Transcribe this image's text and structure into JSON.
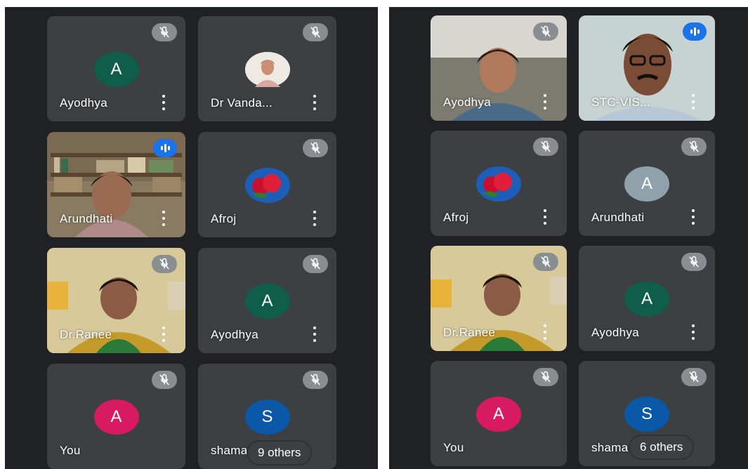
{
  "colors": {
    "background": "#202124",
    "tile": "#3c4043",
    "speaking": "#1a73e8",
    "muted_badge": "#8a8d91"
  },
  "icons": {
    "muted": "mic-off-icon",
    "speaking": "audio-level-icon",
    "menu": "more-vert-icon"
  },
  "left": {
    "tiles": [
      {
        "name": "Ayodhya",
        "avatar_letter": "A",
        "avatar_color": "#0f5e49"
      },
      {
        "name": "Dr Vanda..."
      },
      {
        "name": "Arundhati"
      },
      {
        "name": "Afroj"
      },
      {
        "name": "Dr.Ranee"
      },
      {
        "name": "Ayodhya",
        "avatar_letter": "A",
        "avatar_color": "#0f5e49"
      },
      {
        "name": "You",
        "avatar_letter": "A",
        "avatar_color": "#d81b60"
      },
      {
        "name": "shama",
        "avatar_letter": "S",
        "avatar_color": "#0b57a8"
      }
    ],
    "others_label": "9 others"
  },
  "right": {
    "tiles": [
      {
        "name": "Ayodhya"
      },
      {
        "name": "STC-VIS..."
      },
      {
        "name": "Afroj"
      },
      {
        "name": "Arundhati",
        "avatar_letter": "A",
        "avatar_color": "#8fa1aa"
      },
      {
        "name": "Dr.Ranee"
      },
      {
        "name": "Ayodhya",
        "avatar_letter": "A",
        "avatar_color": "#0f5e49"
      },
      {
        "name": "You",
        "avatar_letter": "A",
        "avatar_color": "#d81b60"
      },
      {
        "name": "shama",
        "avatar_letter": "S",
        "avatar_color": "#0b57a8"
      }
    ],
    "others_label": "6 others"
  }
}
